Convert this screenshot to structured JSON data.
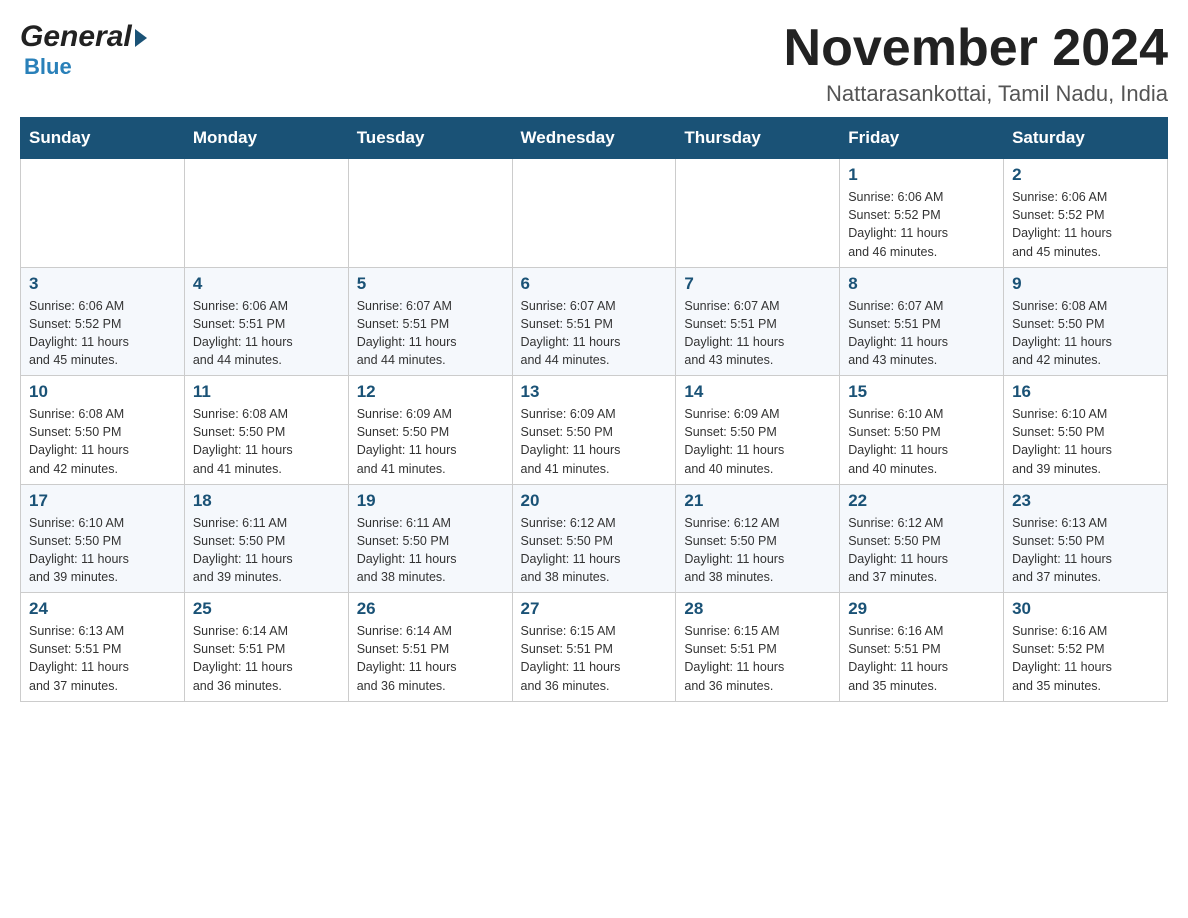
{
  "logo": {
    "general": "General",
    "blue": "Blue"
  },
  "title": "November 2024",
  "subtitle": "Nattarasankottai, Tamil Nadu, India",
  "days": [
    "Sunday",
    "Monday",
    "Tuesday",
    "Wednesday",
    "Thursday",
    "Friday",
    "Saturday"
  ],
  "weeks": [
    [
      {
        "day": "",
        "info": ""
      },
      {
        "day": "",
        "info": ""
      },
      {
        "day": "",
        "info": ""
      },
      {
        "day": "",
        "info": ""
      },
      {
        "day": "",
        "info": ""
      },
      {
        "day": "1",
        "info": "Sunrise: 6:06 AM\nSunset: 5:52 PM\nDaylight: 11 hours\nand 46 minutes."
      },
      {
        "day": "2",
        "info": "Sunrise: 6:06 AM\nSunset: 5:52 PM\nDaylight: 11 hours\nand 45 minutes."
      }
    ],
    [
      {
        "day": "3",
        "info": "Sunrise: 6:06 AM\nSunset: 5:52 PM\nDaylight: 11 hours\nand 45 minutes."
      },
      {
        "day": "4",
        "info": "Sunrise: 6:06 AM\nSunset: 5:51 PM\nDaylight: 11 hours\nand 44 minutes."
      },
      {
        "day": "5",
        "info": "Sunrise: 6:07 AM\nSunset: 5:51 PM\nDaylight: 11 hours\nand 44 minutes."
      },
      {
        "day": "6",
        "info": "Sunrise: 6:07 AM\nSunset: 5:51 PM\nDaylight: 11 hours\nand 44 minutes."
      },
      {
        "day": "7",
        "info": "Sunrise: 6:07 AM\nSunset: 5:51 PM\nDaylight: 11 hours\nand 43 minutes."
      },
      {
        "day": "8",
        "info": "Sunrise: 6:07 AM\nSunset: 5:51 PM\nDaylight: 11 hours\nand 43 minutes."
      },
      {
        "day": "9",
        "info": "Sunrise: 6:08 AM\nSunset: 5:50 PM\nDaylight: 11 hours\nand 42 minutes."
      }
    ],
    [
      {
        "day": "10",
        "info": "Sunrise: 6:08 AM\nSunset: 5:50 PM\nDaylight: 11 hours\nand 42 minutes."
      },
      {
        "day": "11",
        "info": "Sunrise: 6:08 AM\nSunset: 5:50 PM\nDaylight: 11 hours\nand 41 minutes."
      },
      {
        "day": "12",
        "info": "Sunrise: 6:09 AM\nSunset: 5:50 PM\nDaylight: 11 hours\nand 41 minutes."
      },
      {
        "day": "13",
        "info": "Sunrise: 6:09 AM\nSunset: 5:50 PM\nDaylight: 11 hours\nand 41 minutes."
      },
      {
        "day": "14",
        "info": "Sunrise: 6:09 AM\nSunset: 5:50 PM\nDaylight: 11 hours\nand 40 minutes."
      },
      {
        "day": "15",
        "info": "Sunrise: 6:10 AM\nSunset: 5:50 PM\nDaylight: 11 hours\nand 40 minutes."
      },
      {
        "day": "16",
        "info": "Sunrise: 6:10 AM\nSunset: 5:50 PM\nDaylight: 11 hours\nand 39 minutes."
      }
    ],
    [
      {
        "day": "17",
        "info": "Sunrise: 6:10 AM\nSunset: 5:50 PM\nDaylight: 11 hours\nand 39 minutes."
      },
      {
        "day": "18",
        "info": "Sunrise: 6:11 AM\nSunset: 5:50 PM\nDaylight: 11 hours\nand 39 minutes."
      },
      {
        "day": "19",
        "info": "Sunrise: 6:11 AM\nSunset: 5:50 PM\nDaylight: 11 hours\nand 38 minutes."
      },
      {
        "day": "20",
        "info": "Sunrise: 6:12 AM\nSunset: 5:50 PM\nDaylight: 11 hours\nand 38 minutes."
      },
      {
        "day": "21",
        "info": "Sunrise: 6:12 AM\nSunset: 5:50 PM\nDaylight: 11 hours\nand 38 minutes."
      },
      {
        "day": "22",
        "info": "Sunrise: 6:12 AM\nSunset: 5:50 PM\nDaylight: 11 hours\nand 37 minutes."
      },
      {
        "day": "23",
        "info": "Sunrise: 6:13 AM\nSunset: 5:50 PM\nDaylight: 11 hours\nand 37 minutes."
      }
    ],
    [
      {
        "day": "24",
        "info": "Sunrise: 6:13 AM\nSunset: 5:51 PM\nDaylight: 11 hours\nand 37 minutes."
      },
      {
        "day": "25",
        "info": "Sunrise: 6:14 AM\nSunset: 5:51 PM\nDaylight: 11 hours\nand 36 minutes."
      },
      {
        "day": "26",
        "info": "Sunrise: 6:14 AM\nSunset: 5:51 PM\nDaylight: 11 hours\nand 36 minutes."
      },
      {
        "day": "27",
        "info": "Sunrise: 6:15 AM\nSunset: 5:51 PM\nDaylight: 11 hours\nand 36 minutes."
      },
      {
        "day": "28",
        "info": "Sunrise: 6:15 AM\nSunset: 5:51 PM\nDaylight: 11 hours\nand 36 minutes."
      },
      {
        "day": "29",
        "info": "Sunrise: 6:16 AM\nSunset: 5:51 PM\nDaylight: 11 hours\nand 35 minutes."
      },
      {
        "day": "30",
        "info": "Sunrise: 6:16 AM\nSunset: 5:52 PM\nDaylight: 11 hours\nand 35 minutes."
      }
    ]
  ]
}
